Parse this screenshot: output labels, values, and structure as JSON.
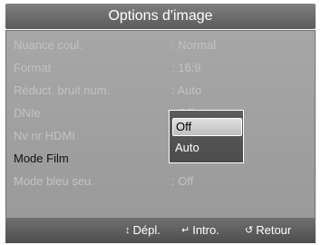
{
  "title": "Options d'image",
  "rows": [
    {
      "label": "Nuance coul.",
      "value": ": Normal"
    },
    {
      "label": "Format",
      "value": ": 16:9"
    },
    {
      "label": "Réduct. bruit num.",
      "value": ": Auto"
    },
    {
      "label": "DNIe",
      "value": ": Off"
    },
    {
      "label": "Nv nr HDMI",
      "value": ""
    },
    {
      "label": "Mode Film",
      "value": ""
    },
    {
      "label": "Mode bleu seu.",
      "value": ": Off"
    }
  ],
  "popup": {
    "options": [
      "Off",
      "Auto"
    ],
    "selected": "Off"
  },
  "footer": {
    "move": {
      "icon": "up-down-arrow-icon",
      "label": "Dépl."
    },
    "enter": {
      "icon": "enter-icon",
      "label": "Intro."
    },
    "back": {
      "icon": "return-arrow-icon",
      "label": "Retour"
    }
  },
  "colors": {
    "panel": "#a0a0a0",
    "title_bar": "#6a6a6a",
    "dim_text": "#c2c2c2",
    "active_text": "#111111"
  }
}
